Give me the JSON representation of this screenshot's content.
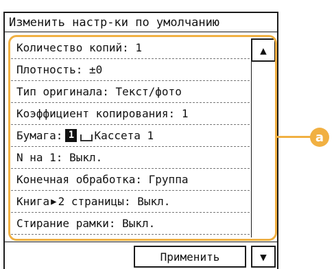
{
  "header": {
    "title": "Изменить настр-ки по умолчанию"
  },
  "list": {
    "items": [
      {
        "label": "Количество копий:   1"
      },
      {
        "label": "Плотность: ±0"
      },
      {
        "label": "Тип оригинала: Текст/фото"
      },
      {
        "label": "Коэффициент копирования: 1"
      },
      {
        "prefix": "Бумага:",
        "paper_number": "1",
        "suffix": "Кассета 1"
      },
      {
        "label": "N на 1: Выкл."
      },
      {
        "label": "Конечная обработка: Группа"
      },
      {
        "prefix": "Книга",
        "suffix": "2 страницы: Выкл."
      },
      {
        "label": "Стирание рамки: Выкл."
      }
    ]
  },
  "controls": {
    "scroll_up_glyph": "▲",
    "scroll_down_glyph": "▼",
    "apply_label": "Применить"
  },
  "callout": {
    "label": "a"
  },
  "colors": {
    "highlight": "#f1b042"
  }
}
